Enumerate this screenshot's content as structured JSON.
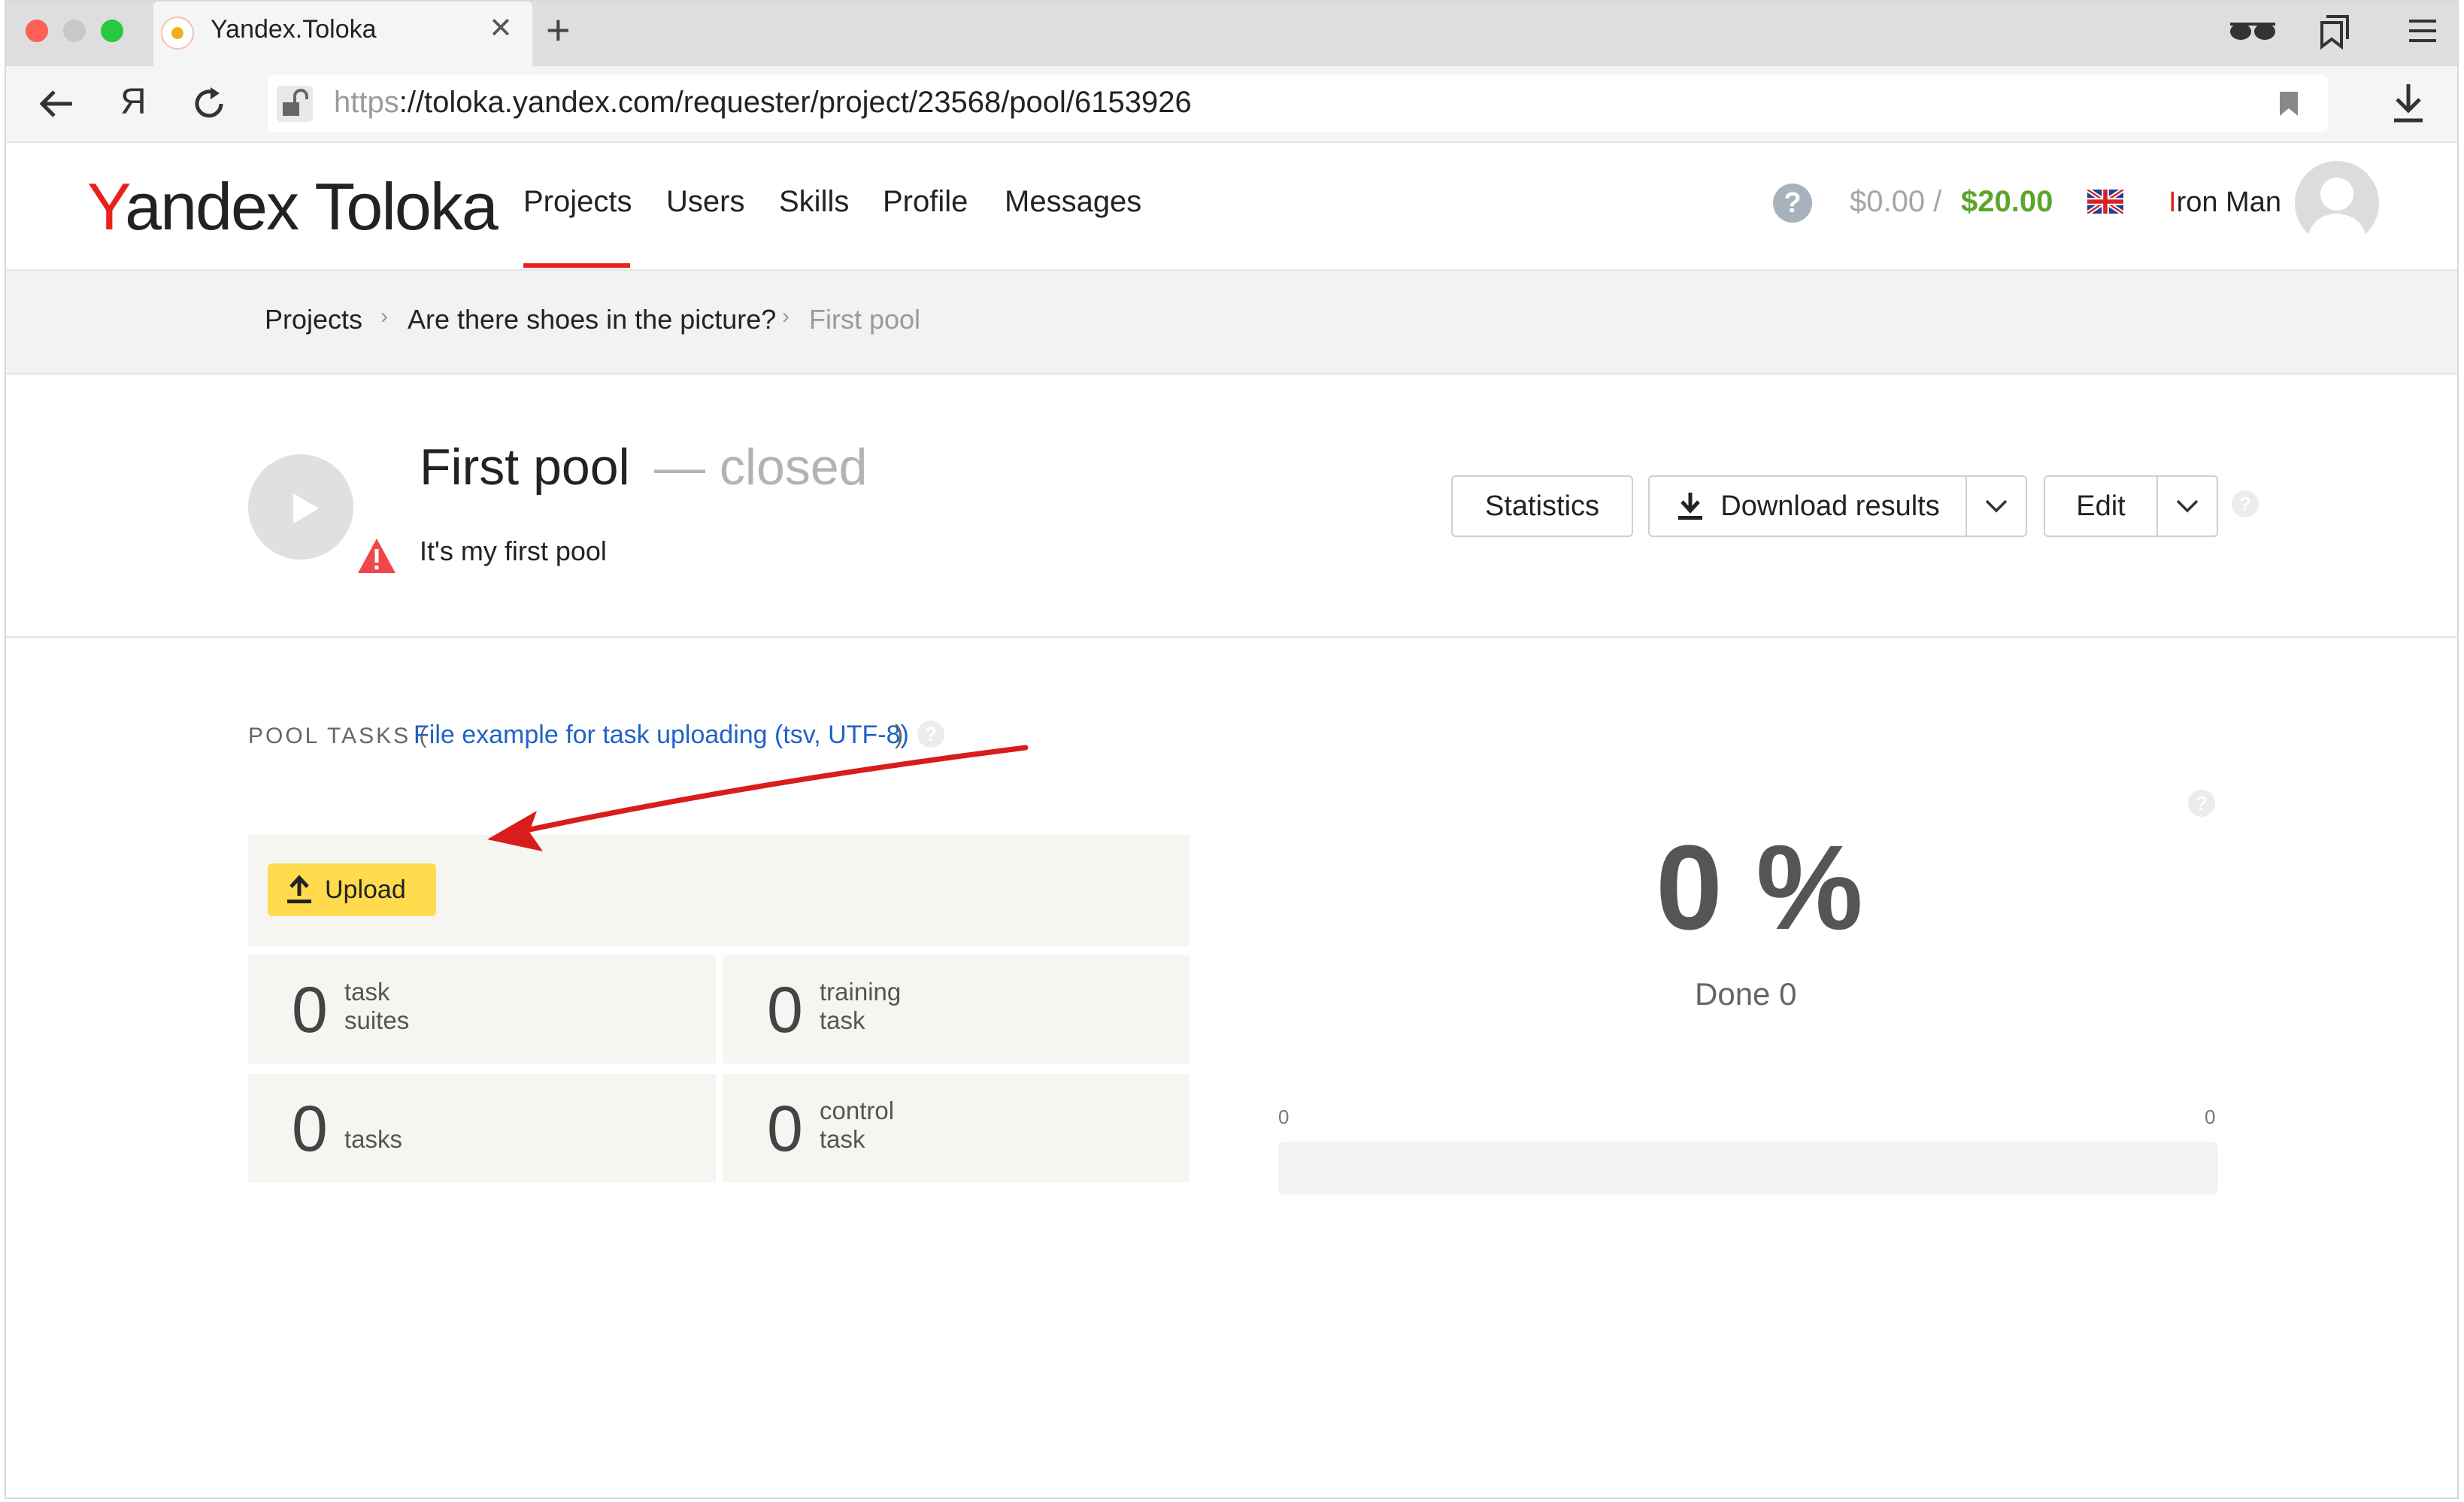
{
  "browser": {
    "tab_title": "Yandex.Toloka",
    "url_scheme": "https",
    "url_rest": "://toloka.yandex.com/requester/project/23568/pool/6153926",
    "yandex_button": "Я"
  },
  "header": {
    "logo_y": "Y",
    "logo_andex": "andex",
    "logo_toloka": "Toloka",
    "nav": [
      "Projects",
      "Users",
      "Skills",
      "Profile",
      "Messages"
    ],
    "active_nav": "Projects",
    "help": "?",
    "balance_spent": "$0.00 /",
    "balance_total": "$20.00",
    "user_first_letter": "I",
    "user_rest": "ron Man"
  },
  "breadcrumbs": {
    "items": [
      "Projects",
      "Are there shoes in the picture?",
      "First pool"
    ],
    "separator": "›"
  },
  "pool": {
    "title": "First pool",
    "status": "— closed",
    "description": "It's my first pool",
    "buttons": {
      "statistics": "Statistics",
      "download": "Download results",
      "edit": "Edit"
    }
  },
  "tasks": {
    "label": "POOL TASKS (",
    "link": "File example for task uploading (tsv, UTF-8)",
    "close_paren": ")",
    "upload_label": "Upload",
    "stats": [
      {
        "count": "0",
        "line1": "task",
        "line2": "suites"
      },
      {
        "count": "0",
        "line1": "training",
        "line2": "task"
      },
      {
        "count": "0",
        "line1": "",
        "line2": "tasks"
      },
      {
        "count": "0",
        "line1": "control",
        "line2": "task"
      }
    ]
  },
  "progress": {
    "percent": "0 %",
    "done_label": "Done 0",
    "min": "0",
    "max": "0",
    "fraction": 0
  },
  "colors": {
    "accent_red": "#e8221a",
    "balance_green": "#5aa62b",
    "upload_yellow": "#ffdb4d",
    "link_blue": "#1f62c9",
    "annotation_arrow": "#d91c1c"
  }
}
